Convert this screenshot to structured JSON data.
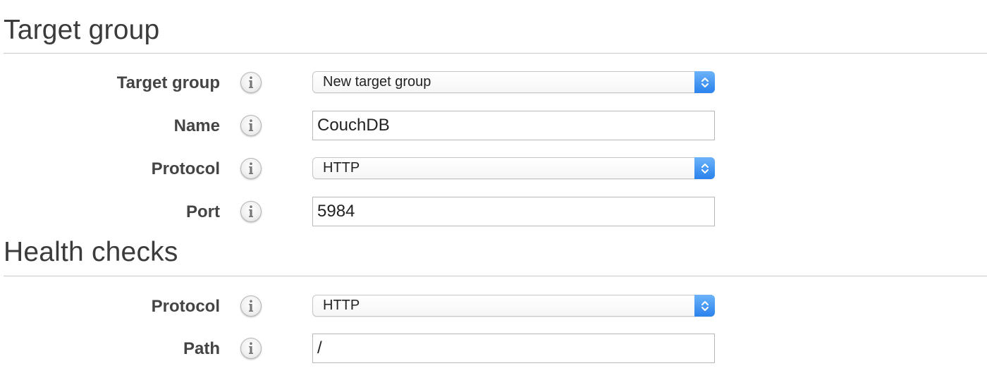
{
  "target_group_section": {
    "title": "Target group",
    "fields": {
      "target_group": {
        "label": "Target group",
        "selected": "New target group",
        "icon": "info-icon"
      },
      "name": {
        "label": "Name",
        "value": "CouchDB",
        "icon": "info-icon"
      },
      "protocol": {
        "label": "Protocol",
        "selected": "HTTP",
        "icon": "info-icon"
      },
      "port": {
        "label": "Port",
        "value": "5984",
        "icon": "info-icon"
      }
    }
  },
  "health_checks_section": {
    "title": "Health checks",
    "fields": {
      "protocol": {
        "label": "Protocol",
        "selected": "HTTP",
        "icon": "info-icon"
      },
      "path": {
        "label": "Path",
        "value": "/",
        "icon": "info-icon"
      }
    }
  },
  "colors": {
    "select_arrow_accent": "#2a82ec",
    "divider": "#c8c8c8",
    "label_text": "#444444"
  }
}
